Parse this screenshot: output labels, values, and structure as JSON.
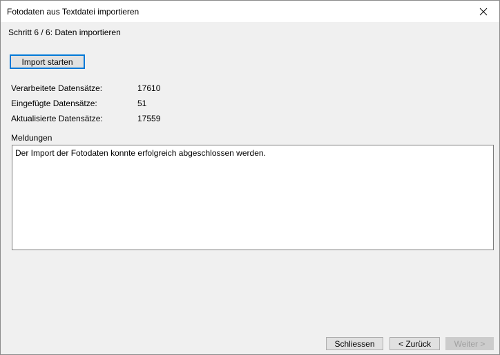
{
  "window": {
    "title": "Fotodaten aus Textdatei importieren",
    "close_icon": "close-icon"
  },
  "step": {
    "header": "Schritt 6 / 6: Daten importieren"
  },
  "actions": {
    "start_import_label": "Import starten"
  },
  "stats": [
    {
      "label": "Verarbeitete Datensätze:",
      "value": "17610"
    },
    {
      "label": "Eingefügte Datensätze:",
      "value": "51"
    },
    {
      "label": "Aktualisierte Datensätze:",
      "value": "17559"
    }
  ],
  "messages": {
    "label": "Meldungen",
    "text": "Der Import der Fotodaten konnte erfolgreich abgeschlossen werden."
  },
  "footer": {
    "close_label": "Schliessen",
    "back_label": "< Zurück",
    "next_label": "Weiter >",
    "next_disabled": true
  },
  "colors": {
    "focus_border": "#0078d7",
    "dialog_background": "#f0f0f0",
    "disabled_text": "#a0a0a0"
  }
}
